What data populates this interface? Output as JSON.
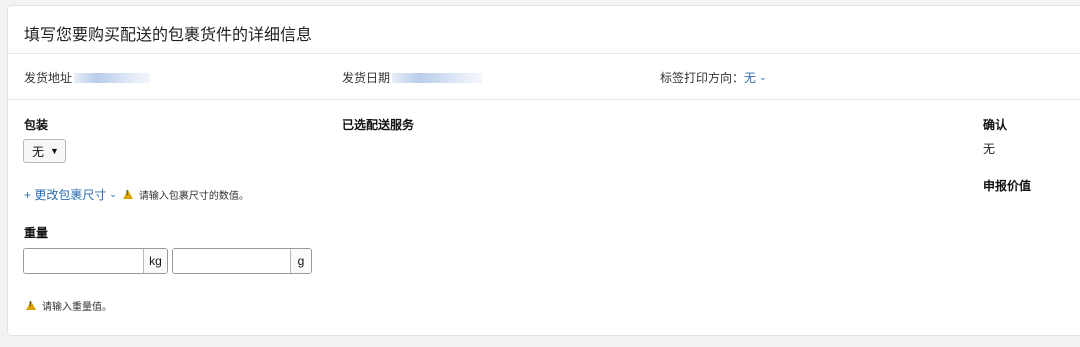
{
  "title": "填写您要购买配送的包裹货件的详细信息",
  "meta": {
    "ship_from_label": "发货地址",
    "ship_date_label": "发货日期",
    "label_orientation_label": "标签打印方向：",
    "label_orientation_value": "无"
  },
  "packaging": {
    "heading": "包装",
    "select_value": "无",
    "change_size_label": "+ 更改包裹尺寸",
    "size_warning": "请输入包裹尺寸的数值。"
  },
  "weight": {
    "heading": "重量",
    "kg_unit": "kg",
    "g_unit": "g",
    "kg_value": "",
    "g_value": "",
    "warning": "请输入重量值。"
  },
  "service": {
    "heading": "已选配送服务"
  },
  "confirm": {
    "heading": "确认",
    "value": "无",
    "declared_value_heading": "申报价值"
  }
}
